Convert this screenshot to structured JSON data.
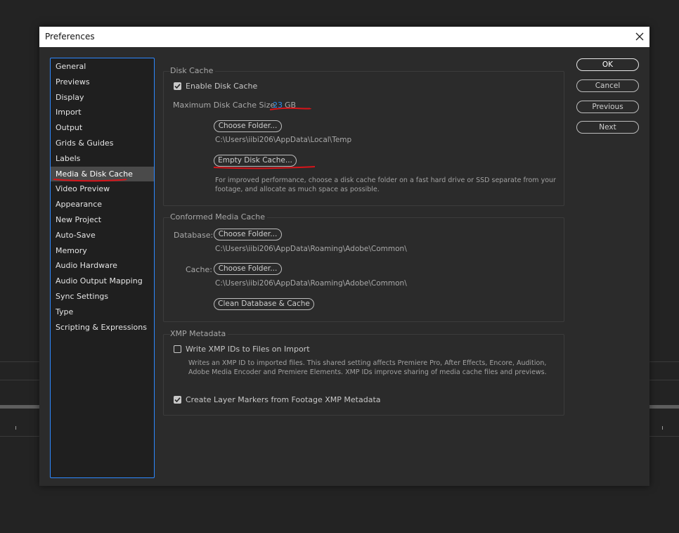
{
  "dialog": {
    "title": "Preferences",
    "close_icon": "close-icon"
  },
  "sidebar": {
    "items": [
      {
        "label": "General"
      },
      {
        "label": "Previews"
      },
      {
        "label": "Display"
      },
      {
        "label": "Import"
      },
      {
        "label": "Output"
      },
      {
        "label": "Grids & Guides"
      },
      {
        "label": "Labels"
      },
      {
        "label": "Media & Disk Cache",
        "selected": true
      },
      {
        "label": "Video Preview"
      },
      {
        "label": "Appearance"
      },
      {
        "label": "New Project"
      },
      {
        "label": "Auto-Save"
      },
      {
        "label": "Memory"
      },
      {
        "label": "Audio Hardware"
      },
      {
        "label": "Audio Output Mapping"
      },
      {
        "label": "Sync Settings"
      },
      {
        "label": "Type"
      },
      {
        "label": "Scripting & Expressions"
      }
    ]
  },
  "disk_cache": {
    "group_label": "Disk Cache",
    "enable_label": "Enable Disk Cache",
    "enable_checked": true,
    "max_size_label": "Maximum Disk Cache Size:",
    "max_size_value": "23",
    "max_size_unit": "GB",
    "choose_folder_label": "Choose Folder...",
    "folder_path": "C:\\Users\\iibi206\\AppData\\Local\\Temp",
    "empty_cache_label": "Empty Disk Cache...",
    "hint_line1": "For improved performance, choose a disk cache folder on a fast hard drive or SSD separate from your",
    "hint_line2": "footage, and allocate as much space as possible."
  },
  "conformed_cache": {
    "group_label": "Conformed Media Cache",
    "database_label": "Database:",
    "database_button": "Choose Folder...",
    "database_path": "C:\\Users\\iibi206\\AppData\\Roaming\\Adobe\\Common\\",
    "cache_label": "Cache:",
    "cache_button": "Choose Folder...",
    "cache_path": "C:\\Users\\iibi206\\AppData\\Roaming\\Adobe\\Common\\",
    "clean_button": "Clean Database & Cache"
  },
  "xmp": {
    "group_label": "XMP Metadata",
    "write_ids_label": "Write XMP IDs to Files on Import",
    "write_ids_checked": false,
    "write_ids_desc1": "Writes an XMP ID to imported files. This shared setting affects Premiere Pro, After Effects, Encore, Audition,",
    "write_ids_desc2": "Adobe Media Encoder and Premiere Elements. XMP IDs improve sharing of media cache files and previews.",
    "layer_markers_label": "Create Layer Markers from Footage XMP Metadata",
    "layer_markers_checked": true
  },
  "buttons": {
    "ok": "OK",
    "cancel": "Cancel",
    "previous": "Previous",
    "next": "Next"
  },
  "colors": {
    "value_link": "#2d8ceb",
    "selection_border": "#2d88ff",
    "annotation_red": "#d8141a"
  }
}
